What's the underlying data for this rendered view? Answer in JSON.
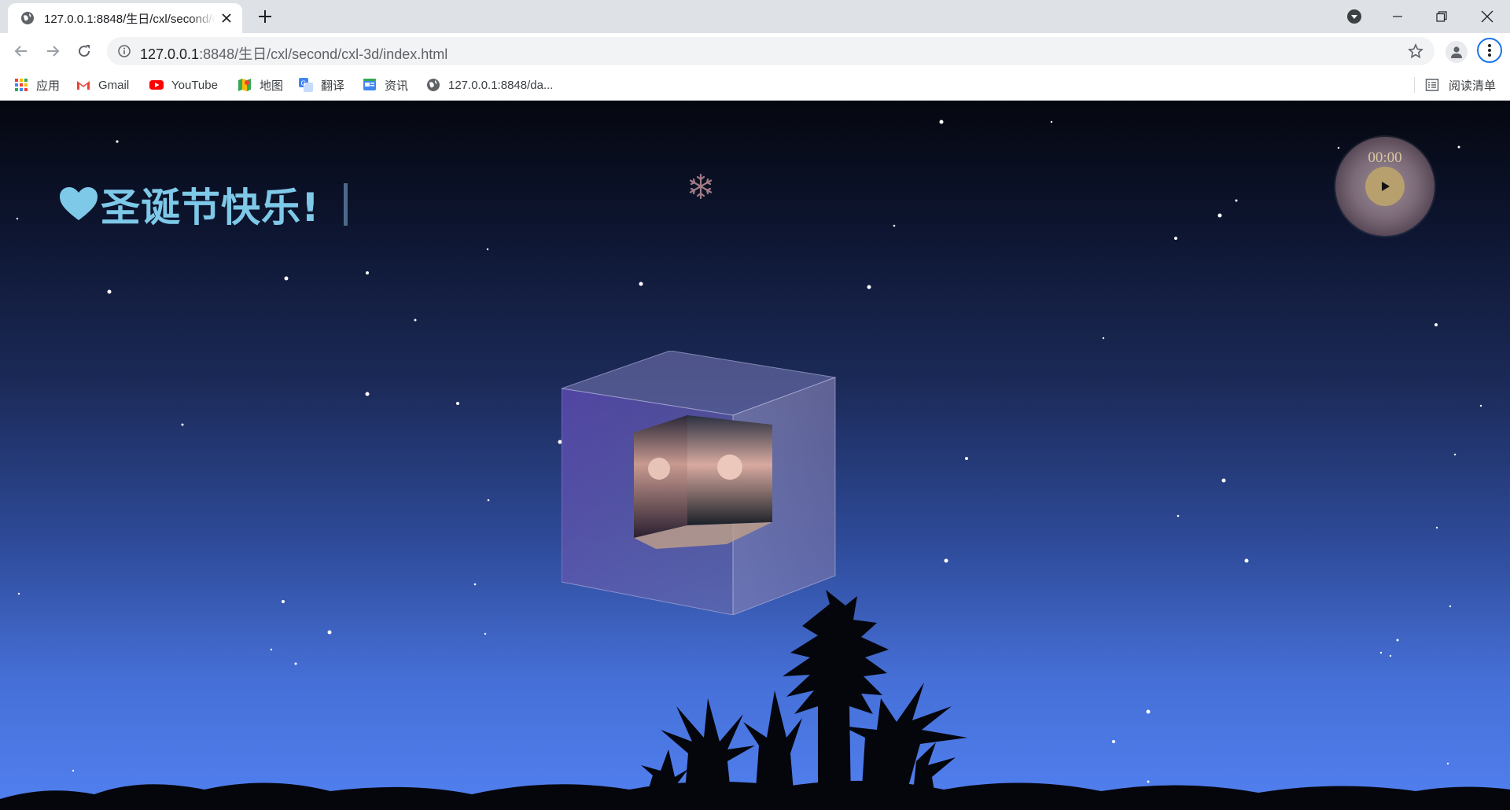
{
  "browser": {
    "tab": {
      "title": "127.0.0.1:8848/生日/cxl/second/cxl-3d/index.html"
    },
    "address": {
      "host": "127.0.0.1",
      "rest": ":8848/生日/cxl/second/cxl-3d/index.html"
    },
    "bookmarks": [
      {
        "label": "应用",
        "icon": "apps-grid-icon"
      },
      {
        "label": "Gmail",
        "icon": "gmail-icon"
      },
      {
        "label": "YouTube",
        "icon": "youtube-icon"
      },
      {
        "label": "地图",
        "icon": "maps-icon"
      },
      {
        "label": "翻译",
        "icon": "translate-icon"
      },
      {
        "label": "资讯",
        "icon": "news-icon"
      },
      {
        "label": "127.0.0.1:8848/da...",
        "icon": "globe-icon"
      }
    ],
    "reading_list": "阅读清单"
  },
  "page": {
    "title": "圣诞节快乐!",
    "player": {
      "time": "00:00"
    }
  },
  "colors": {
    "title": "#7ec8e8",
    "player_accent": "#b8a06e",
    "sky_top": "#05070f",
    "sky_bottom": "#5180f0"
  }
}
